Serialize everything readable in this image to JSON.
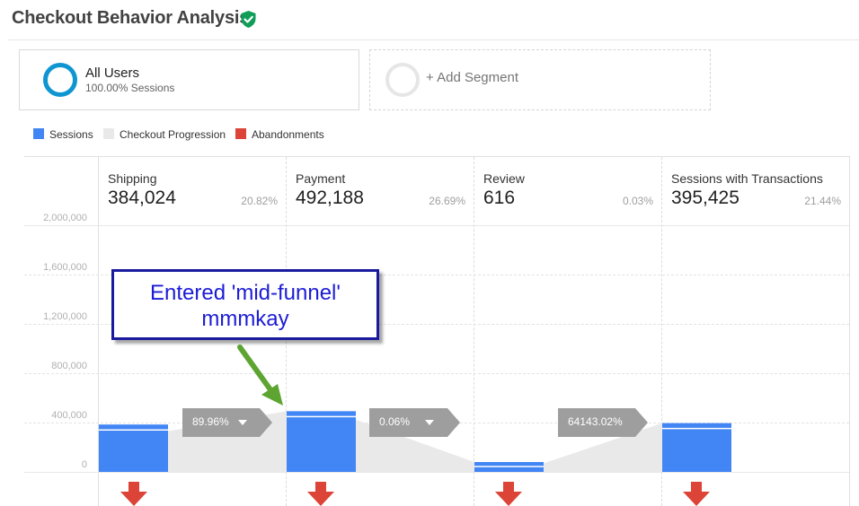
{
  "page": {
    "title": "Checkout Behavior Analysis"
  },
  "segments": [
    {
      "name": "All Users",
      "detail": "100.00% Sessions"
    },
    {
      "name": "+ Add Segment",
      "detail": ""
    }
  ],
  "legend": [
    {
      "label": "Sessions",
      "color": "#4285f4"
    },
    {
      "label": "Checkout Progression",
      "color": "#e9e9e9"
    },
    {
      "label": "Abandonments",
      "color": "#db4437"
    }
  ],
  "y_axis": {
    "ticks": [
      "2,000,000",
      "1,600,000",
      "1,200,000",
      "800,000",
      "400,000",
      "0"
    ],
    "max": 2000000
  },
  "steps": [
    {
      "name": "Shipping",
      "value": "384,024",
      "percent": "20.82%",
      "sessions": 384024
    },
    {
      "name": "Payment",
      "value": "492,188",
      "percent": "26.69%",
      "sessions": 492188
    },
    {
      "name": "Review",
      "value": "616",
      "percent": "0.03%",
      "sessions": 616
    },
    {
      "name": "Sessions with Transactions",
      "value": "395,425",
      "percent": "21.44%",
      "sessions": 395425
    }
  ],
  "progressions": [
    {
      "label": "89.96%",
      "has_menu": true
    },
    {
      "label": "0.06%",
      "has_menu": true
    },
    {
      "label": "64143.02%",
      "has_menu": false
    }
  ],
  "annotation": {
    "line1": "Entered 'mid-funnel'",
    "line2": "mmmkay"
  },
  "colors": {
    "sessions": "#4285f4",
    "progression": "#e9e9e9",
    "abandon": "#db4437",
    "chip": "#9e9e9e",
    "verified": "#0f9d58",
    "callout_text": "#1c1cd6",
    "callout_border": "#1a1a9e",
    "pointer": "#5da431"
  },
  "icons": {
    "verified": "verified-shield-check-icon",
    "abandon": "arrow-down-icon",
    "menu": "caret-down-icon"
  }
}
